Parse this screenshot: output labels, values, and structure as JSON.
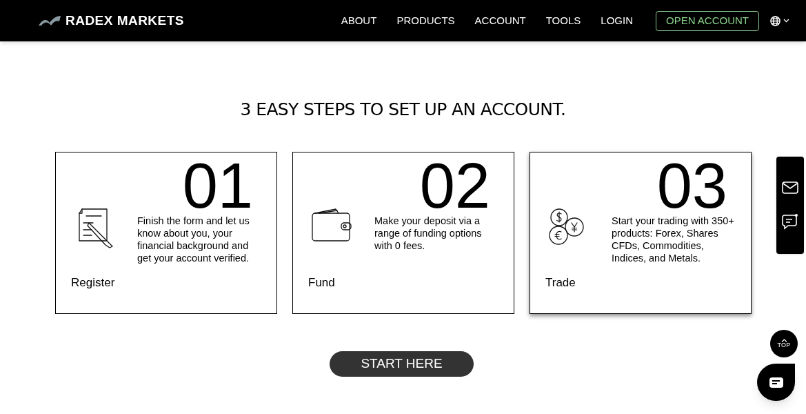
{
  "brand": "RADEX MARKETS",
  "nav": [
    "ABOUT",
    "PRODUCTS",
    "ACCOUNT",
    "TOOLS",
    "LOGIN"
  ],
  "open_account": "OPEN ACCOUNT",
  "heading": "3 EASY STEPS TO SET UP AN ACCOUNT.",
  "steps": [
    {
      "number": "01",
      "kind": "register",
      "description": "Finish the form and let us know about you, your financial background and get your account verified.",
      "title": "Register",
      "selected": false
    },
    {
      "number": "02",
      "kind": "fund",
      "description": "Make your deposit via a range of funding options with 0 fees.",
      "title": "Fund",
      "selected": false
    },
    {
      "number": "03",
      "kind": "trade",
      "description": "Start your trading with 350+ products: Forex, Shares CFDs, Commodities, Indices, and Metals.",
      "title": "Trade",
      "selected": true
    }
  ],
  "start_button": "START HERE",
  "top_button": "TOP"
}
